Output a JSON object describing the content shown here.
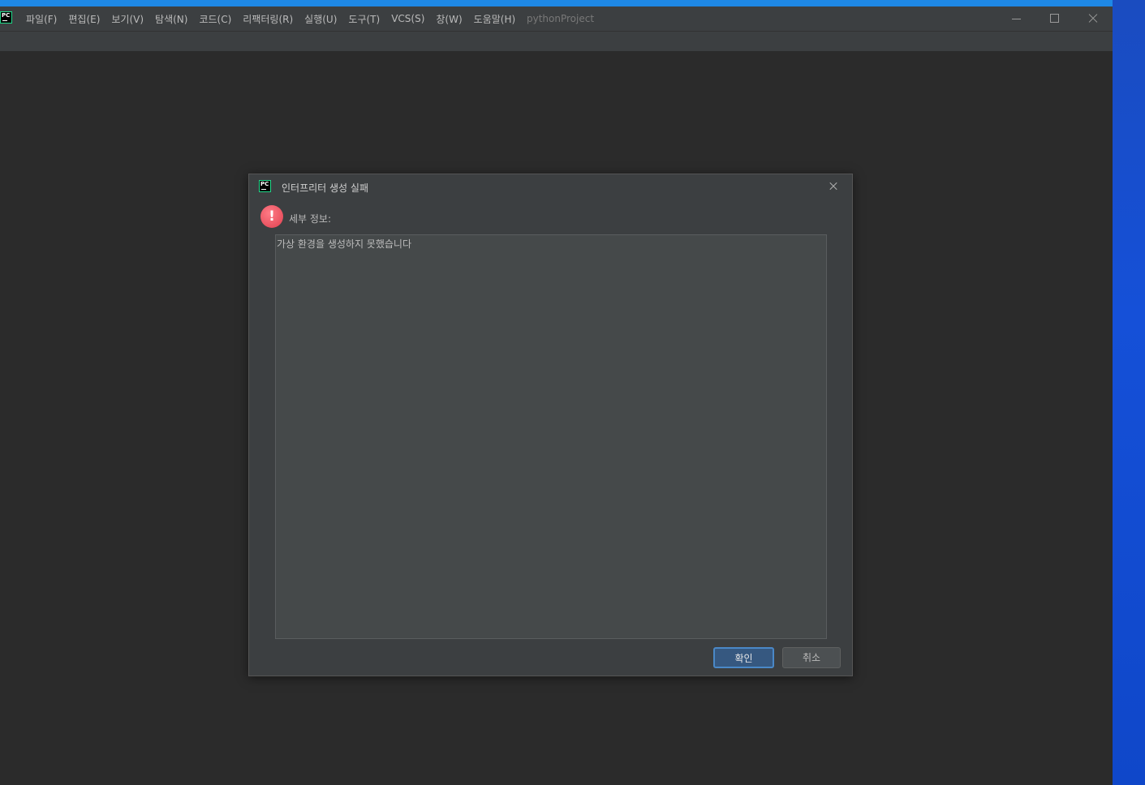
{
  "app": {
    "logo_text": "PC",
    "project_name": "pythonProject"
  },
  "menu": {
    "items": [
      "파일(F)",
      "편집(E)",
      "보기(V)",
      "탐색(N)",
      "코드(C)",
      "리팩터링(R)",
      "실행(U)",
      "도구(T)",
      "VCS(S)",
      "창(W)",
      "도움말(H)"
    ]
  },
  "dialog": {
    "title": "인터프리터 생성 실패",
    "icon": "error-icon",
    "details_label": "세부 정보:",
    "details_text": "가상 환경을 생성하지 못했습니다",
    "ok_label": "확인",
    "cancel_label": "취소"
  },
  "colors": {
    "background": "#2b2b2b",
    "dialog_bg": "#3c3f41",
    "accent": "#365880",
    "error": "#e0404f"
  }
}
